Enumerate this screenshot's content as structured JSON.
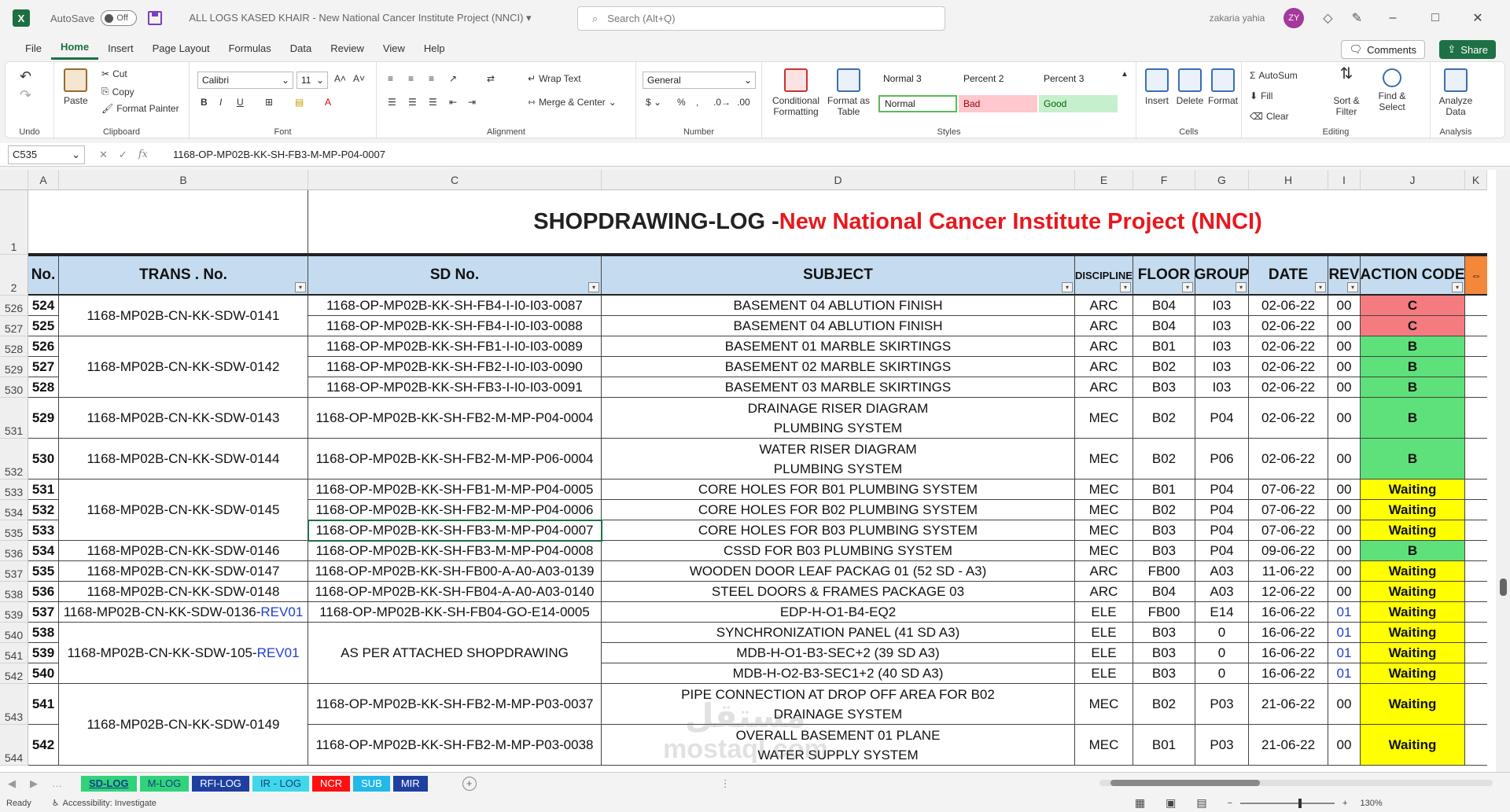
{
  "titlebar": {
    "autosave_label": "AutoSave",
    "autosave_state": "Off",
    "doc_title": "ALL LOGS KASED KHAIR  -  New National Cancer Institute Project (NNCI)  ▾",
    "search_placeholder": "Search (Alt+Q)",
    "user_name": "zakaria yahia",
    "user_initials": "ZY"
  },
  "menu_tabs": [
    "File",
    "Home",
    "Insert",
    "Page Layout",
    "Formulas",
    "Data",
    "Review",
    "View",
    "Help"
  ],
  "comments_label": "Comments",
  "share_label": "Share",
  "ribbon": {
    "undo_label": "Undo",
    "clipboard": {
      "paste": "Paste",
      "cut": "Cut",
      "copy": "Copy",
      "format_painter": "Format Painter",
      "label": "Clipboard"
    },
    "font": {
      "name": "Calibri",
      "size": "11",
      "label": "Font"
    },
    "alignment": {
      "wrap": "Wrap Text",
      "merge": "Merge & Center",
      "label": "Alignment"
    },
    "number": {
      "format": "General",
      "label": "Number"
    },
    "styles": {
      "cond": "Conditional Formatting",
      "table": "Format as Table",
      "label": "Styles",
      "cells": [
        {
          "name": "Normal 3",
          "bg": "#ffffff"
        },
        {
          "name": "Percent 2",
          "bg": "#ffffff"
        },
        {
          "name": "Percent 3",
          "bg": "#ffffff"
        },
        {
          "name": "Normal",
          "bg": "#ffffff"
        },
        {
          "name": "Bad",
          "bg": "#ffc7ce"
        },
        {
          "name": "Good",
          "bg": "#c6efce"
        }
      ]
    },
    "cells_group": {
      "insert": "Insert",
      "delete": "Delete",
      "format": "Format",
      "label": "Cells"
    },
    "editing": {
      "autosum": "AutoSum",
      "fill": "Fill",
      "clear": "Clear",
      "sort": "Sort & Filter",
      "find": "Find & Select",
      "label": "Editing"
    },
    "analysis": {
      "analyze": "Analyze Data",
      "label": "Analysis"
    }
  },
  "formula_bar": {
    "name_box": "C535",
    "formula": "1168-OP-MP02B-KK-SH-FB3-M-MP-P04-0007"
  },
  "columns": [
    "A",
    "B",
    "C",
    "D",
    "E",
    "F",
    "G",
    "H",
    "I",
    "J",
    "K"
  ],
  "sheet_title": {
    "black": "SHOPDRAWING-LOG - ",
    "red": "New National Cancer Institute Project (NNCI)"
  },
  "headers": {
    "no": "No.",
    "trans": "TRANS . No.",
    "sd": "SD No.",
    "subject": "SUBJECT",
    "discipline": "DISCIPLINE",
    "floor": "FLOOR",
    "group": "GROUP",
    "date": "DATE",
    "rev": "REV",
    "action": "ACTION CODE"
  },
  "row_numbers": [
    "1",
    "2",
    "526",
    "527",
    "528",
    "529",
    "530",
    "531",
    "532",
    "533",
    "534",
    "535",
    "536",
    "537",
    "538",
    "539",
    "540",
    "541",
    "542",
    "543",
    "544"
  ],
  "rows": [
    {
      "no": "524",
      "sd": "1168-OP-MP02B-KK-SH-FB4-I-I0-I03-0087",
      "subject": "BASEMENT 04 ABLUTION FINISH",
      "disc": "ARC",
      "floor": "B04",
      "group": "I03",
      "date": "02-06-22",
      "rev": "00",
      "action": "C"
    },
    {
      "no": "525",
      "sd": "1168-OP-MP02B-KK-SH-FB4-I-I0-I03-0088",
      "subject": "BASEMENT 04 ABLUTION FINISH",
      "disc": "ARC",
      "floor": "B04",
      "group": "I03",
      "date": "02-06-22",
      "rev": "00",
      "action": "C"
    },
    {
      "no": "526",
      "sd": "1168-OP-MP02B-KK-SH-FB1-I-I0-I03-0089",
      "subject": "BASEMENT 01 MARBLE SKIRTINGS",
      "disc": "ARC",
      "floor": "B01",
      "group": "I03",
      "date": "02-06-22",
      "rev": "00",
      "action": "B"
    },
    {
      "no": "527",
      "sd": "1168-OP-MP02B-KK-SH-FB2-I-I0-I03-0090",
      "subject": "BASEMENT 02 MARBLE SKIRTINGS",
      "disc": "ARC",
      "floor": "B02",
      "group": "I03",
      "date": "02-06-22",
      "rev": "00",
      "action": "B"
    },
    {
      "no": "528",
      "sd": "1168-OP-MP02B-KK-SH-FB3-I-I0-I03-0091",
      "subject": "BASEMENT 03 MARBLE SKIRTINGS",
      "disc": "ARC",
      "floor": "B03",
      "group": "I03",
      "date": "02-06-22",
      "rev": "00",
      "action": "B"
    },
    {
      "no": "529",
      "sd": "1168-OP-MP02B-KK-SH-FB2-M-MP-P04-0004",
      "subject": "DRAINAGE RISER DIAGRAM",
      "subject2": "PLUMBING SYSTEM",
      "disc": "MEC",
      "floor": "B02",
      "group": "P04",
      "date": "02-06-22",
      "rev": "00",
      "action": "B"
    },
    {
      "no": "530",
      "sd": "1168-OP-MP02B-KK-SH-FB2-M-MP-P06-0004",
      "subject": "WATER RISER DIAGRAM",
      "subject2": "PLUMBING SYSTEM",
      "disc": "MEC",
      "floor": "B02",
      "group": "P06",
      "date": "02-06-22",
      "rev": "00",
      "action": "B"
    },
    {
      "no": "531",
      "sd": "1168-OP-MP02B-KK-SH-FB1-M-MP-P04-0005",
      "subject": "CORE HOLES FOR B01 PLUMBING SYSTEM",
      "disc": "MEC",
      "floor": "B01",
      "group": "P04",
      "date": "07-06-22",
      "rev": "00",
      "action": "Waiting"
    },
    {
      "no": "532",
      "sd": "1168-OP-MP02B-KK-SH-FB2-M-MP-P04-0006",
      "subject": "CORE HOLES FOR B02 PLUMBING SYSTEM",
      "disc": "MEC",
      "floor": "B02",
      "group": "P04",
      "date": "07-06-22",
      "rev": "00",
      "action": "Waiting"
    },
    {
      "no": "533",
      "sd": "1168-OP-MP02B-KK-SH-FB3-M-MP-P04-0007",
      "subject": "CORE HOLES FOR B03 PLUMBING SYSTEM",
      "disc": "MEC",
      "floor": "B03",
      "group": "P04",
      "date": "07-06-22",
      "rev": "00",
      "action": "Waiting"
    },
    {
      "no": "534",
      "sd": "1168-OP-MP02B-KK-SH-FB3-M-MP-P04-0008",
      "subject": "CSSD FOR B03 PLUMBING SYSTEM",
      "disc": "MEC",
      "floor": "B03",
      "group": "P04",
      "date": "09-06-22",
      "rev": "00",
      "action": "B"
    },
    {
      "no": "535",
      "sd": "1168-OP-MP02B-KK-SH-FB00-A-A0-A03-0139",
      "subject": "WOODEN DOOR LEAF PACKAG 01 (52 SD - A3)",
      "disc": "ARC",
      "floor": "FB00",
      "group": "A03",
      "date": "11-06-22",
      "rev": "00",
      "action": "Waiting"
    },
    {
      "no": "536",
      "sd": "1168-OP-MP02B-KK-SH-FB04-A-A0-A03-0140",
      "subject": "STEEL DOORS & FRAMES PACKAGE 03",
      "disc": "ARC",
      "floor": "B04",
      "group": "A03",
      "date": "12-06-22",
      "rev": "00",
      "action": "Waiting"
    },
    {
      "no": "537",
      "sd": "1168-OP-MP02B-KK-SH-FB04-GO-E14-0005",
      "subject": "EDP-H-O1-B4-EQ2",
      "disc": "ELE",
      "floor": "FB00",
      "group": "E14",
      "date": "16-06-22",
      "rev": "01",
      "action": "Waiting"
    },
    {
      "no": "538",
      "sd": "",
      "subject": "SYNCHRONIZATION PANEL (41 SD A3)",
      "disc": "ELE",
      "floor": "B03",
      "group": "0",
      "date": "16-06-22",
      "rev": "01",
      "action": "Waiting"
    },
    {
      "no": "539",
      "sd": "",
      "subject": "MDB-H-O1-B3-SEC+2 (39 SD A3)",
      "disc": "ELE",
      "floor": "B03",
      "group": "0",
      "date": "16-06-22",
      "rev": "01",
      "action": "Waiting"
    },
    {
      "no": "540",
      "sd": "",
      "subject": "MDB-H-O2-B3-SEC1+2 (40 SD A3)",
      "disc": "ELE",
      "floor": "B03",
      "group": "0",
      "date": "16-06-22",
      "rev": "01",
      "action": "Waiting"
    },
    {
      "no": "541",
      "sd": "1168-OP-MP02B-KK-SH-FB2-M-MP-P03-0037",
      "subject": "PIPE CONNECTION AT DROP OFF AREA FOR B02",
      "subject2": "DRAINAGE SYSTEM",
      "disc": "MEC",
      "floor": "B02",
      "group": "P03",
      "date": "21-06-22",
      "rev": "00",
      "action": "Waiting"
    },
    {
      "no": "542",
      "sd": "1168-OP-MP02B-KK-SH-FB2-M-MP-P03-0038",
      "subject": "OVERALL BASEMENT 01 PLANE",
      "subject2": "WATER SUPPLY SYSTEM",
      "disc": "MEC",
      "floor": "B01",
      "group": "P03",
      "date": "21-06-22",
      "rev": "00",
      "action": "Waiting"
    }
  ],
  "trans_groups": [
    {
      "text": "1168-MP02B-CN-KK-SDW-0141",
      "suffix": ""
    },
    {
      "text": "1168-MP02B-CN-KK-SDW-0142",
      "suffix": ""
    },
    {
      "text": "1168-MP02B-CN-KK-SDW-0143",
      "suffix": ""
    },
    {
      "text": "1168-MP02B-CN-KK-SDW-0144",
      "suffix": ""
    },
    {
      "text": "1168-MP02B-CN-KK-SDW-0145",
      "suffix": ""
    },
    {
      "text": "1168-MP02B-CN-KK-SDW-0146",
      "suffix": ""
    },
    {
      "text": "1168-MP02B-CN-KK-SDW-0147",
      "suffix": ""
    },
    {
      "text": "1168-MP02B-CN-KK-SDW-0148",
      "suffix": ""
    },
    {
      "text": "1168-MP02B-CN-KK-SDW-0136-",
      "suffix": "REV01"
    },
    {
      "text": "1168-MP02B-CN-KK-SDW-105-",
      "suffix": "REV01"
    },
    {
      "text": "1168-MP02B-CN-KK-SDW-0149",
      "suffix": ""
    }
  ],
  "merged_sd_text": "AS PER ATTACHED SHOPDRAWING",
  "action_colors": {
    "C": "#f47b80",
    "B": "#5ee07a",
    "Waiting": "#ffff00"
  },
  "sheet_tabs": [
    {
      "name": "SD-LOG",
      "bg": "#2fd47a",
      "fg": "#1a3a8a",
      "active": true
    },
    {
      "name": "M-LOG",
      "bg": "#2fd47a",
      "fg": "#1a3a8a"
    },
    {
      "name": "RFI-LOG",
      "bg": "#1f3fa0",
      "fg": "#ffffff"
    },
    {
      "name": "IR - LOG",
      "bg": "#3fd8e8",
      "fg": "#1a3a8a"
    },
    {
      "name": "NCR",
      "bg": "#ff1010",
      "fg": "#ffffff"
    },
    {
      "name": "SUB",
      "bg": "#22b8e8",
      "fg": "#ffffff"
    },
    {
      "name": "MIR",
      "bg": "#1f3fa0",
      "fg": "#ffffff"
    }
  ],
  "status": {
    "ready": "Ready",
    "accessibility": "Accessibility: Investigate",
    "zoom": "130%"
  },
  "watermark": {
    "line1": "مستقل",
    "line2": "mostaql.com"
  }
}
